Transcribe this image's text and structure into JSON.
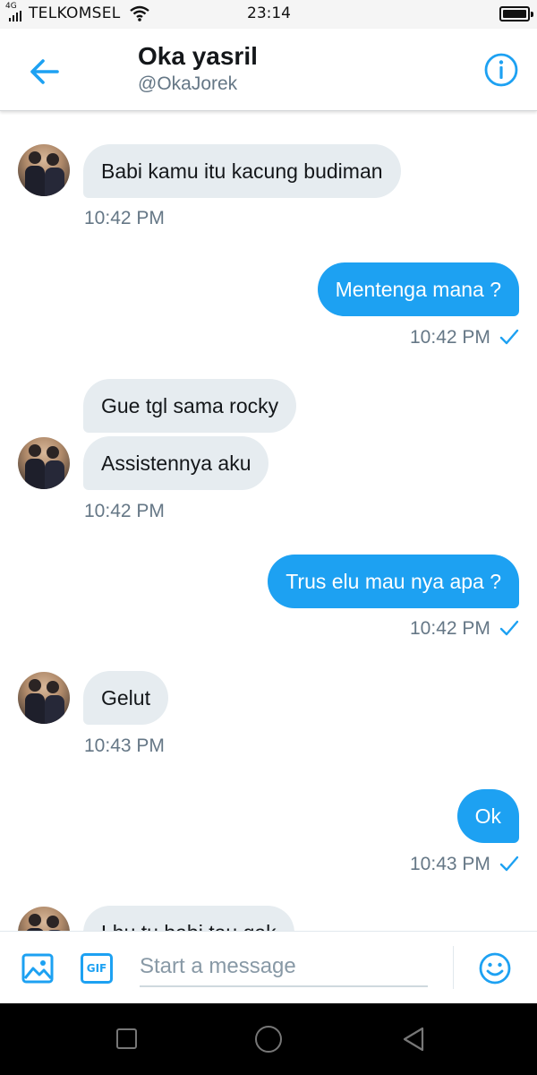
{
  "status_bar": {
    "network": "4G",
    "carrier": "TELKOMSEL",
    "time": "23:14",
    "icons": [
      "signal-icon",
      "wifi-icon",
      "battery-icon"
    ]
  },
  "header": {
    "name": "Oka yasril",
    "handle": "@OkaJorek",
    "icons": [
      "back-arrow-icon",
      "info-icon"
    ],
    "accent_color": "#1da1f2"
  },
  "messages": [
    {
      "from": "them",
      "text": "Babi kamu itu kacung budiman",
      "time": "10:42 PM"
    },
    {
      "from": "me",
      "text": "Mentenga mana ?",
      "time": "10:42 PM",
      "read": true
    },
    {
      "from": "them",
      "text": "Gue tgl sama rocky"
    },
    {
      "from": "them",
      "text": "Assistennya aku",
      "time": "10:42 PM"
    },
    {
      "from": "me",
      "text": "Trus elu mau nya apa ?",
      "time": "10:42 PM",
      "read": true
    },
    {
      "from": "them",
      "text": "Gelut",
      "time": "10:43 PM"
    },
    {
      "from": "me",
      "text": "Ok",
      "time": "10:43 PM",
      "read": true
    },
    {
      "from": "them",
      "text": "Lhu tu babi tau gak"
    }
  ],
  "composer": {
    "placeholder": "Start a message",
    "gif_label": "GIF",
    "icons": [
      "image-icon",
      "gif-icon",
      "emoji-icon"
    ]
  },
  "nav_bar": {
    "icons": [
      "recent-apps-icon",
      "home-icon",
      "back-icon"
    ]
  },
  "colors": {
    "incoming_bubble": "#e6ecf0",
    "outgoing_bubble": "#1da1f2",
    "timestamp": "#657786"
  }
}
